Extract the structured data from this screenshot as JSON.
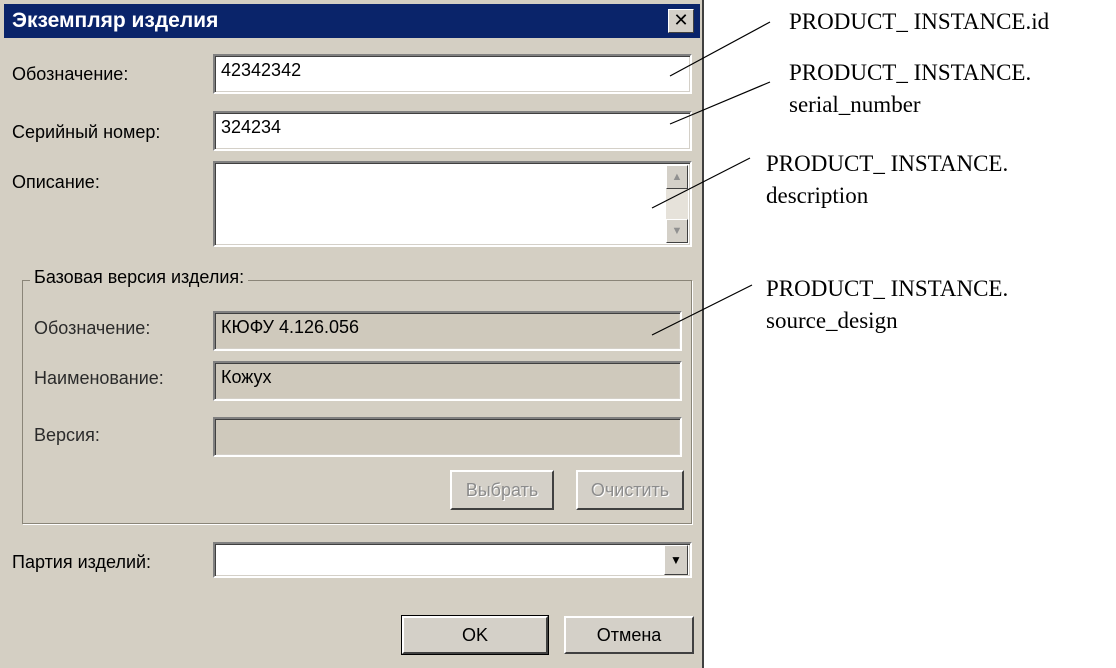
{
  "dialog": {
    "title": "Экземпляр изделия",
    "close_glyph": "✕",
    "designation_label": "Обозначение:",
    "designation_value": "42342342",
    "serial_label": "Серийный номер:",
    "serial_value": "324234",
    "description_label": "Описание:",
    "description_value": "",
    "base_version": {
      "legend": "Базовая версия изделия:",
      "designation_label": "Обозначение:",
      "designation_value": "КЮФУ 4.126.056",
      "name_label": "Наименование:",
      "name_value": "Кожух",
      "version_label": "Версия:",
      "version_value": "",
      "select_button": "Выбрать",
      "clear_button": "Очистить"
    },
    "batch_label": "Партия изделий:",
    "batch_value": "",
    "ok_button": "OK",
    "cancel_button": "Отмена"
  },
  "annotations": [
    {
      "line1": "PRODUCT_ INSTANCE.id",
      "line2": ""
    },
    {
      "line1": "PRODUCT_ INSTANCE.",
      "line2": "serial_number"
    },
    {
      "line1": "PRODUCT_ INSTANCE.",
      "line2": "description"
    },
    {
      "line1": "PRODUCT_ INSTANCE.",
      "line2": "source_design"
    }
  ],
  "icons": {
    "scroll_up": "scroll-up-arrow-icon",
    "scroll_down": "scroll-down-arrow-icon",
    "dropdown": "dropdown-arrow-icon"
  }
}
